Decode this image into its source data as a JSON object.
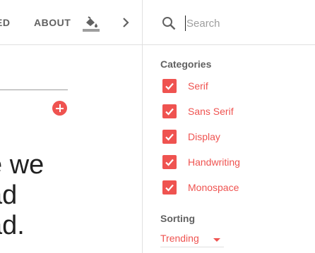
{
  "nav": {
    "selected_partial": "ED",
    "about": "ABOUT"
  },
  "icons": {
    "paint": "format-color-fill-icon",
    "chevron": "chevron-right-icon",
    "search": "search-icon",
    "add": "add-circle-icon",
    "checkbox": "checkbox-checked-icon"
  },
  "preview": {
    "text": "e we\nad\nad."
  },
  "search": {
    "placeholder": "Search"
  },
  "categories": {
    "label": "Categories",
    "items": [
      {
        "label": "Serif",
        "checked": true
      },
      {
        "label": "Sans Serif",
        "checked": true
      },
      {
        "label": "Display",
        "checked": true
      },
      {
        "label": "Handwriting",
        "checked": true
      },
      {
        "label": "Monospace",
        "checked": true
      }
    ]
  },
  "sorting": {
    "label": "Sorting",
    "value": "Trending"
  },
  "colors": {
    "accent": "#ef5350",
    "text_muted": "#616161",
    "divider": "#e0e0e0"
  }
}
